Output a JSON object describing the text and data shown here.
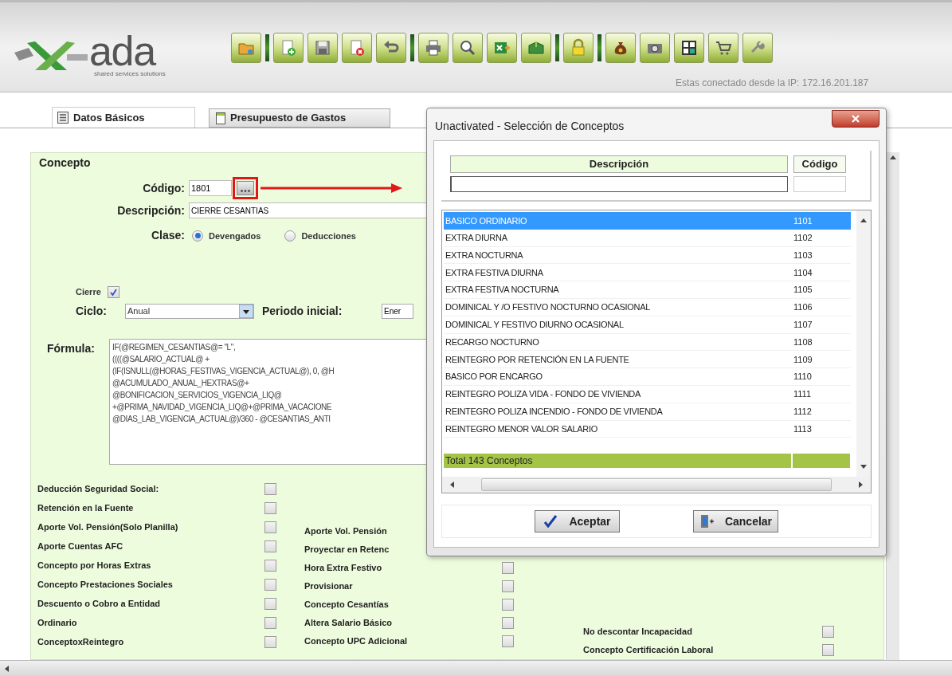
{
  "header": {
    "logo_text": "ada",
    "logo_tagline": "shared services solutions",
    "connection": "Estas conectado desde la IP: 172.16.201.187"
  },
  "tabs": [
    {
      "label": "Datos Básicos",
      "selected": true
    },
    {
      "label": "Presupuesto de Gastos",
      "selected": false
    }
  ],
  "form": {
    "legend": "Concepto",
    "codigo": {
      "label": "Código:",
      "value": "1801"
    },
    "descripcion": {
      "label": "Descripción:",
      "value": "CIERRE CESANTIAS"
    },
    "clase": {
      "label": "Clase:",
      "options": [
        {
          "label": "Devengados",
          "selected": true
        },
        {
          "label": "Deducciones",
          "selected": false
        }
      ]
    },
    "cierre": {
      "label": "Cierre",
      "checked": true
    },
    "ciclo": {
      "label": "Ciclo:",
      "value": "Anual"
    },
    "periodo": {
      "label": "Periodo inicial:",
      "value": "Ener"
    },
    "formula": {
      "label": "Fórmula:",
      "lines": [
        "IF(@REGIMEN_CESANTIAS@= \"L\",",
        "((((@SALARIO_ACTUAL@ +",
        "(IF(ISNULL(@HORAS_FESTIVAS_VIGENCIA_ACTUAL@), 0, @H",
        "@ACUMULADO_ANUAL_HEXTRAS@+",
        "@BONIFICACION_SERVICIOS_VIGENCIA_LIQ@",
        "+@PRIMA_NAVIDAD_VIGENCIA_LIQ@+@PRIMA_VACACIONE",
        "@DIAS_LAB_VIGENCIA_ACTUAL@)/360 - @CESANTIAS_ANTI"
      ]
    }
  },
  "flags_left": [
    {
      "kind": "check",
      "label": "Deducción Seguridad Social:",
      "checked": false
    },
    {
      "kind": "check",
      "label": "Retención en la Fuente",
      "checked": false
    },
    {
      "kind": "check",
      "label": "Aporte Vol. Pensión(Solo Planilla)",
      "checked": false
    },
    {
      "kind": "check",
      "label": "Aporte Cuentas AFC",
      "checked": false
    },
    {
      "kind": "check",
      "label": "Concepto por Horas Extras",
      "checked": false
    },
    {
      "kind": "check",
      "label": "Concepto Prestaciones Sociales",
      "checked": false
    },
    {
      "kind": "check",
      "label": "Descuento o Cobro a Entidad",
      "checked": false
    },
    {
      "kind": "check",
      "label": "Ordinario",
      "checked": false
    },
    {
      "kind": "check",
      "label": "ConceptoxReintegro",
      "checked": false
    }
  ],
  "flags_middle": [
    {
      "kind": "label",
      "label": "Aporte Vol. Pensión"
    },
    {
      "kind": "label",
      "label": "Proyectar en Retenc"
    },
    {
      "kind": "check",
      "label": "Hora Extra Festivo",
      "checked": false
    },
    {
      "kind": "check",
      "label": "Provisionar",
      "checked": false
    },
    {
      "kind": "check",
      "label": "Concepto Cesantías",
      "checked": false
    },
    {
      "kind": "check",
      "label": "Altera Salario Básico",
      "checked": false
    },
    {
      "kind": "check",
      "label": "Concepto UPC Adicional",
      "checked": false
    }
  ],
  "flags_right": [
    {
      "kind": "check",
      "label": "No descontar Incapacidad",
      "checked": false
    },
    {
      "kind": "check",
      "label": "Concepto Certificación Laboral",
      "checked": false
    }
  ],
  "dialog": {
    "title": "Unactivated - Selección de Conceptos",
    "columns": [
      "Descripción",
      "Código"
    ],
    "rows": [
      {
        "descripcion": "BASICO ORDINARIO",
        "codigo": "1101",
        "selected": true
      },
      {
        "descripcion": "EXTRA DIURNA",
        "codigo": "1102",
        "selected": false
      },
      {
        "descripcion": "EXTRA NOCTURNA",
        "codigo": "1103",
        "selected": false
      },
      {
        "descripcion": "EXTRA FESTIVA DIURNA",
        "codigo": "1104",
        "selected": false
      },
      {
        "descripcion": "EXTRA FESTIVA NOCTURNA",
        "codigo": "1105",
        "selected": false
      },
      {
        "descripcion": "DOMINICAL Y /O FESTIVO NOCTURNO OCASIONAL",
        "codigo": "1106",
        "selected": false
      },
      {
        "descripcion": "DOMINICAL Y FESTIVO DIURNO OCASIONAL",
        "codigo": "1107",
        "selected": false
      },
      {
        "descripcion": "RECARGO NOCTURNO",
        "codigo": "1108",
        "selected": false
      },
      {
        "descripcion": "REINTEGRO POR RETENCIÓN EN LA FUENTE",
        "codigo": "1109",
        "selected": false
      },
      {
        "descripcion": "BASICO POR ENCARGO",
        "codigo": "1110",
        "selected": false
      },
      {
        "descripcion": "REINTEGRO POLIZA VIDA - FONDO DE VIVIENDA",
        "codigo": "1111",
        "selected": false
      },
      {
        "descripcion": "REINTEGRO POLIZA INCENDIO - FONDO DE VIVIENDA",
        "codigo": "1112",
        "selected": false
      },
      {
        "descripcion": "REINTEGRO MENOR VALOR SALARIO",
        "codigo": "1113",
        "selected": false
      }
    ],
    "total": "Total 143 Conceptos",
    "buttons": [
      "Aceptar",
      "Cancelar"
    ]
  }
}
